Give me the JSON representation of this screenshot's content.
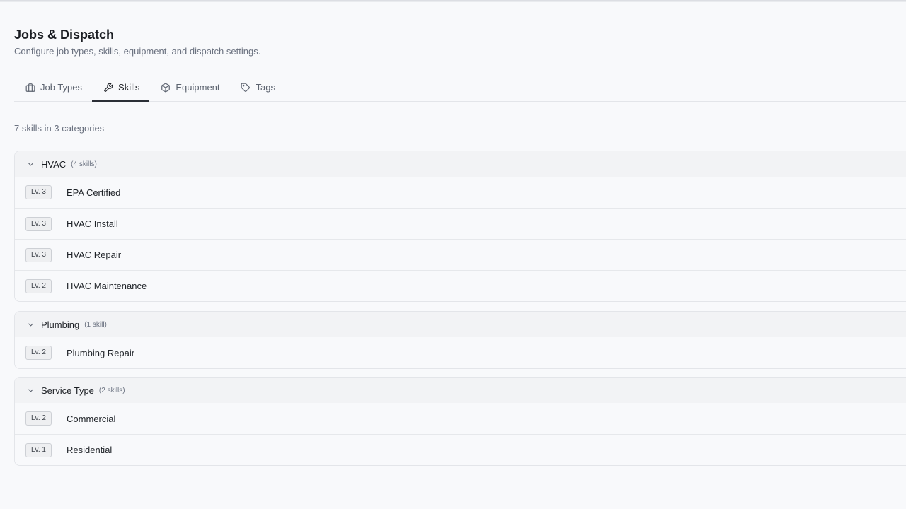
{
  "header": {
    "title": "Jobs & Dispatch",
    "subtitle": "Configure job types, skills, equipment, and dispatch settings."
  },
  "tabs": [
    {
      "label": "Job Types",
      "icon": "briefcase-icon",
      "active": false
    },
    {
      "label": "Skills",
      "icon": "wrench-icon",
      "active": true
    },
    {
      "label": "Equipment",
      "icon": "box-icon",
      "active": false
    },
    {
      "label": "Tags",
      "icon": "tag-icon",
      "active": false
    }
  ],
  "summary": "7 skills in 3 categories",
  "groups": [
    {
      "name": "HVAC",
      "count": "(4 skills)",
      "skills": [
        {
          "level": "Lv. 3",
          "name": "EPA Certified"
        },
        {
          "level": "Lv. 3",
          "name": "HVAC Install"
        },
        {
          "level": "Lv. 3",
          "name": "HVAC Repair"
        },
        {
          "level": "Lv. 2",
          "name": "HVAC Maintenance"
        }
      ]
    },
    {
      "name": "Plumbing",
      "count": "(1 skill)",
      "skills": [
        {
          "level": "Lv. 2",
          "name": "Plumbing Repair"
        }
      ]
    },
    {
      "name": "Service Type",
      "count": "(2 skills)",
      "skills": [
        {
          "level": "Lv. 2",
          "name": "Commercial"
        },
        {
          "level": "Lv. 1",
          "name": "Residential"
        }
      ]
    }
  ],
  "colors": {
    "background": "#f8f9fb",
    "active_tab_underline": "#2b2f36",
    "group_header_bg": "#f2f3f5",
    "badge_bg": "#eeeff1",
    "border": "#e3e5e9"
  }
}
